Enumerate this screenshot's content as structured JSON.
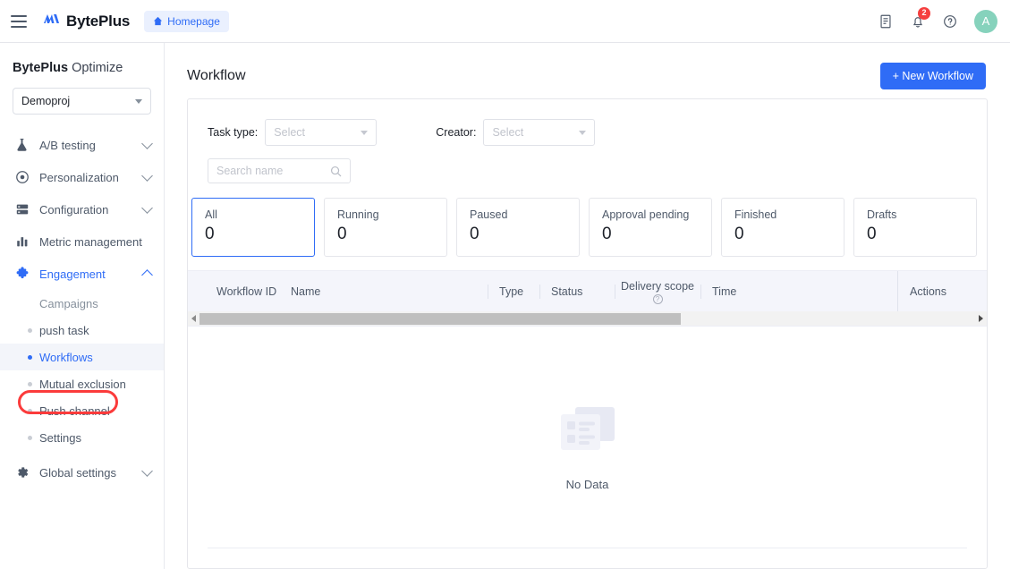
{
  "topbar": {
    "menu_icon": "hamburger-icon",
    "brand_mark": "M",
    "brand_name": "BytePlus",
    "homepage_label": "Homepage",
    "home_icon": "home-icon",
    "doc_icon": "document-icon",
    "bell_icon": "bell-icon",
    "notification_count": "2",
    "help_icon": "help-circle-icon",
    "avatar_initial": "A"
  },
  "sidebar": {
    "product_brand": "BytePlus",
    "product_suffix": " Optimize",
    "project": {
      "value": "Demoproj",
      "caret_icon": "caret-down-icon"
    },
    "items": [
      {
        "label": "A/B testing",
        "icon": "flask-icon",
        "arrow": "chevron-down-icon"
      },
      {
        "label": "Personalization",
        "icon": "target-icon",
        "arrow": "chevron-down-icon"
      },
      {
        "label": "Configuration",
        "icon": "server-icon",
        "arrow": "chevron-down-icon"
      },
      {
        "label": "Metric management",
        "icon": "bar-chart-icon",
        "arrow": ""
      },
      {
        "label": "Engagement",
        "icon": "puzzle-icon",
        "arrow": "chevron-up-icon"
      }
    ],
    "engagement_group_label": "Campaigns",
    "sub_items": [
      {
        "label": "push task"
      },
      {
        "label": "Workflows"
      },
      {
        "label": "Mutual exclusion"
      },
      {
        "label": "Push channel"
      },
      {
        "label": "Settings"
      }
    ],
    "global_settings": {
      "label": "Global settings",
      "icon": "gear-icon",
      "arrow": "chevron-down-icon"
    }
  },
  "main": {
    "page_title": "Workflow",
    "new_button": "+ New Workflow",
    "filters": {
      "task_type_label": "Task type:",
      "task_type_value": "Select",
      "creator_label": "Creator:",
      "creator_value": "Select",
      "search_placeholder": "Search name",
      "search_value": "",
      "search_icon": "search-icon"
    },
    "cards": [
      {
        "label": "All",
        "value": "0"
      },
      {
        "label": "Running",
        "value": "0"
      },
      {
        "label": "Paused",
        "value": "0"
      },
      {
        "label": "Approval pending",
        "value": "0"
      },
      {
        "label": "Finished",
        "value": "0"
      },
      {
        "label": "Drafts",
        "value": "0"
      }
    ],
    "table": {
      "columns": [
        {
          "label": "Workflow ID"
        },
        {
          "label": "Name"
        },
        {
          "label": "Type"
        },
        {
          "label": "Status"
        },
        {
          "label": "Delivery scope",
          "help_icon": "question-circle-icon"
        },
        {
          "label": "Time"
        }
      ],
      "actions_column": "Actions",
      "empty_text": "No Data",
      "empty_icon": "empty-document-icon"
    }
  },
  "colors": {
    "accent": "#2f6cf6",
    "badge": "#f53f3f",
    "highlight_box": "#fb3b3b",
    "avatar": "#86d2bc",
    "table_header_bg": "#f4f5fb"
  }
}
